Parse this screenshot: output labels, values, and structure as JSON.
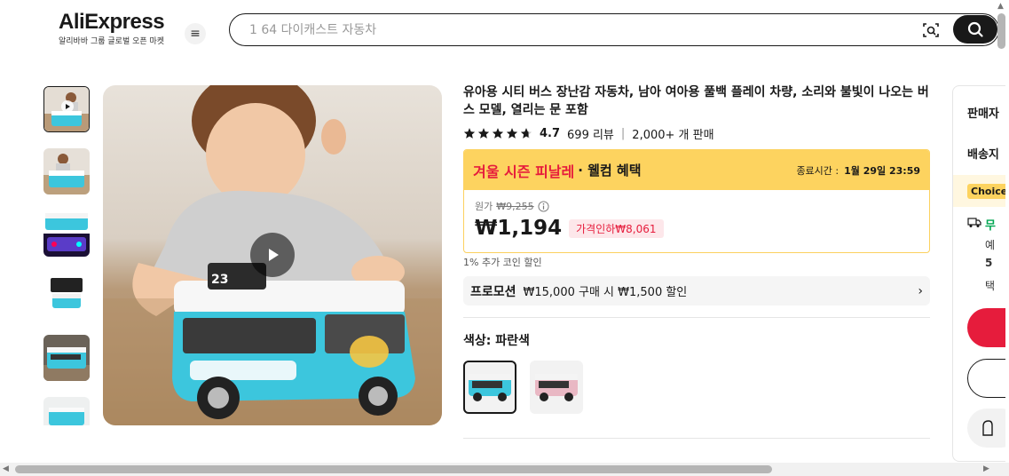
{
  "header": {
    "logo": "AliExpress",
    "logo_sub": "알리바바 그룹 글로벌 오픈 마켓",
    "search_placeholder": "1 64 다이캐스트 자동차"
  },
  "product": {
    "title": "유아용 시티 버스 장난감 자동차, 남아 여아용 풀백 플레이 차량, 소리와 불빛이 나오는 버스 모델, 열리는 문 포함",
    "rating": "4.7",
    "rating_fraction": 0.94,
    "reviews": "699 리뷰",
    "sold": "2,000+ 개 판매"
  },
  "promo": {
    "sale_label": "겨울 시즌 피날레",
    "welcome_label": "· 웰컴 혜택",
    "end_label": "종료시간 :",
    "end_time": "1월 29일 23:59",
    "original_label": "원가",
    "original_price": "₩9,255",
    "price": "₩1,194",
    "discount": "가격인하₩8,061"
  },
  "coin_text": "1% 추가 코인 할인",
  "promotion": {
    "label": "프로모션",
    "text": "₩15,000 구매 시 ₩1,500 할인"
  },
  "color": {
    "label": "색상: 파란색"
  },
  "right_panel": {
    "seller": "판매자",
    "shipping": "배송지",
    "choice": "Choice",
    "free": "무",
    "line1": "예",
    "line2": "5",
    "line3": "택"
  },
  "colors": {
    "accent": "#e61c3c",
    "promo_yellow": "#fdd35f",
    "bus_blue": "#3cc6dd",
    "bus_pink": "#e9b8c4"
  }
}
